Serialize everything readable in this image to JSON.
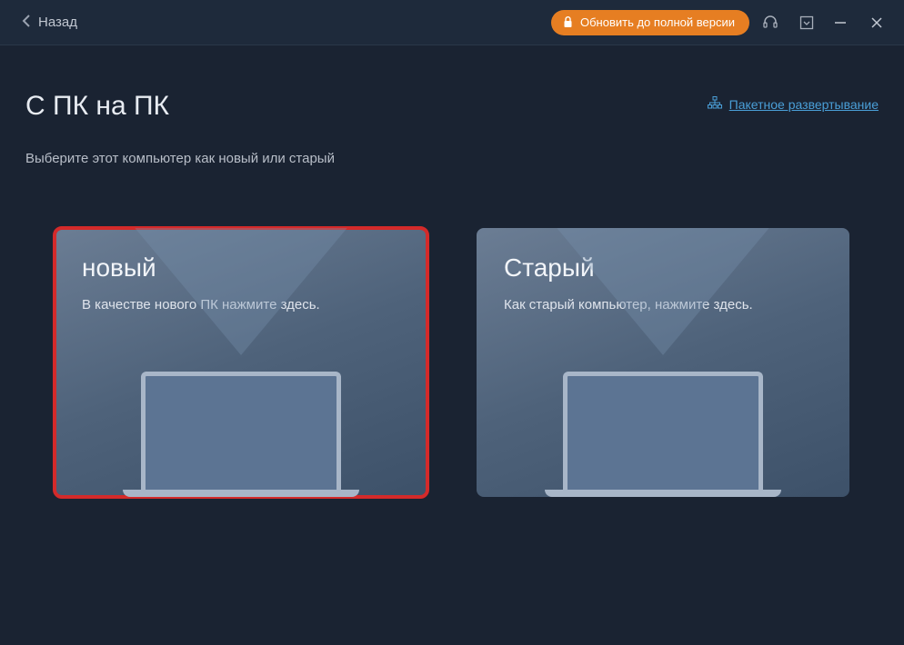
{
  "titlebar": {
    "back_label": "Назад",
    "upgrade_label": "Обновить до полной версии"
  },
  "header": {
    "title": "С ПК на ПК",
    "deploy_link": "Пакетное развертывание",
    "subtitle": "Выберите этот компьютер как новый или старый"
  },
  "cards": {
    "new": {
      "title": "новый",
      "desc": "В качестве нового ПК нажмите здесь."
    },
    "old": {
      "title": "Старый",
      "desc": "Как старый компьютер, нажмите здесь."
    }
  }
}
